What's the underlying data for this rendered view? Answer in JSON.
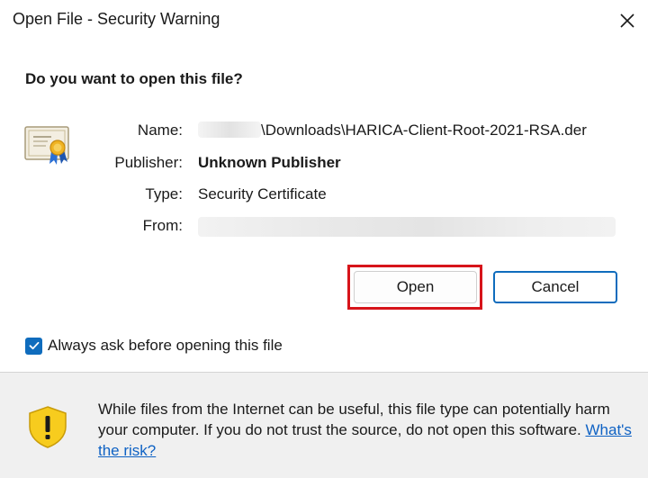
{
  "window": {
    "title": "Open File - Security Warning",
    "close_icon": "close-icon"
  },
  "dialog": {
    "question": "Do you want to open this file?",
    "icon": "certificate-icon",
    "fields": {
      "name_label": "Name:",
      "name_value": "\\Downloads\\HARICA-Client-Root-2021-RSA.der",
      "publisher_label": "Publisher:",
      "publisher_value": "Unknown Publisher",
      "type_label": "Type:",
      "type_value": "Security Certificate",
      "from_label": "From:"
    },
    "buttons": {
      "open": "Open",
      "cancel": "Cancel"
    },
    "checkbox": {
      "label": "Always ask before opening this file",
      "checked": true
    }
  },
  "footer": {
    "icon": "warning-shield-icon",
    "text": "While files from the Internet can be useful, this file type can potentially harm your computer. If you do not trust the source, do not open this software.",
    "link": "What's the risk?"
  },
  "colors": {
    "accent": "#0f6cbd",
    "highlight": "#d7141a",
    "link": "#0f62c4",
    "shield": "#f7cc1e"
  }
}
